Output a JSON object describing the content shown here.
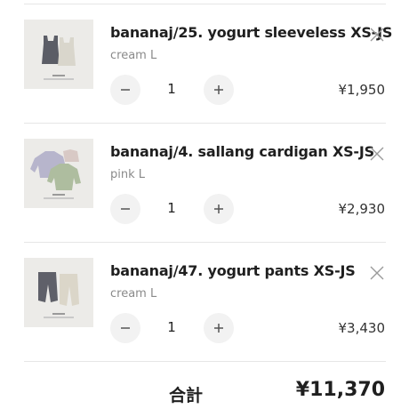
{
  "items": [
    {
      "title": "bananaj/25. yogurt sleeveless XS-JS",
      "variant": "cream L",
      "quantity": "1",
      "price": "¥1,950",
      "image_icon": "sleeveless-tops-thumbnail"
    },
    {
      "title": "bananaj/4. sallang cardigan XS-JS",
      "variant": "pink L",
      "quantity": "1",
      "price": "¥2,930",
      "image_icon": "cardigan-thumbnail"
    },
    {
      "title": "bananaj/47. yogurt pants XS-JS",
      "variant": "cream L",
      "quantity": "1",
      "price": "¥3,430",
      "image_icon": "pants-thumbnail"
    }
  ],
  "total": {
    "label": "合計",
    "value": "¥11,370"
  },
  "colors": {
    "button_bg": "#f2f2f2",
    "divider": "#e6e6e6",
    "variant_text": "#8a8a8a"
  }
}
